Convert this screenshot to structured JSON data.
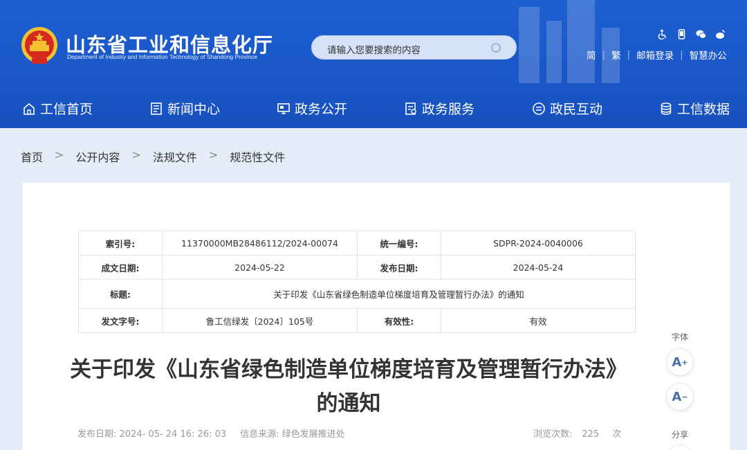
{
  "header": {
    "site_title": "山东省工业和信息化厅",
    "site_subtitle": "Department of Industry and Information Technology of Shandong Province",
    "search_placeholder": "请输入您要搜索的内容",
    "links": [
      "简",
      "繁",
      "邮箱登录",
      "智慧办公"
    ],
    "icons": [
      "accessibility-icon",
      "mobile-icon",
      "wechat-icon",
      "weibo-icon"
    ]
  },
  "nav": [
    {
      "label": "工信首页",
      "icon": "home-icon"
    },
    {
      "label": "新闻中心",
      "icon": "news-icon"
    },
    {
      "label": "政务公开",
      "icon": "monitor-icon"
    },
    {
      "label": "政务服务",
      "icon": "service-icon"
    },
    {
      "label": "政民互动",
      "icon": "chat-icon"
    },
    {
      "label": "工信数据",
      "icon": "database-icon"
    }
  ],
  "breadcrumb": [
    "首页",
    "公开内容",
    "法规文件",
    "规范性文件"
  ],
  "meta": {
    "index_label": "索引号:",
    "index_value": "11370000MB28486112/2024-00074",
    "code_label": "统一编号:",
    "code_value": "SDPR-2024-0040006",
    "made_label": "成文日期:",
    "made_value": "2024-05-22",
    "pub_label": "发布日期:",
    "pub_value": "2024-05-24",
    "title_label": "标题:",
    "title_value": "关于印发《山东省绿色制造单位梯度培育及管理暂行办法》的通知",
    "doc_label": "发文字号:",
    "doc_value": "鲁工信绿发〔2024〕105号",
    "valid_label": "有效性:",
    "valid_value": "有效"
  },
  "article": {
    "title": "关于印发《山东省绿色制造单位梯度培育及管理暂行办法》的通知",
    "publish": "发布日期: 2024- 05- 24 16: 26: 03",
    "source": "信息来源: 绿色发展推进处",
    "views_label": "浏览次数:",
    "views": "225",
    "views_unit": "次"
  },
  "side": {
    "font_label": "字体",
    "font_up": "A",
    "font_down": "A",
    "share_label": "分享"
  },
  "colors": {
    "header_blue": "#1a58c8",
    "page_bg": "#e4ecf7"
  }
}
